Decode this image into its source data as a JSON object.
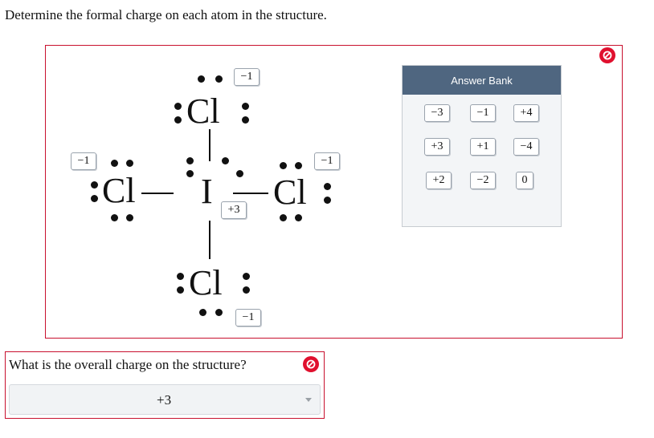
{
  "question": "Determine the formal charge on each atom in the structure.",
  "structure": {
    "atoms": {
      "top": "Cl",
      "left": "Cl",
      "center": "I",
      "right": "Cl",
      "bottom": "Cl"
    },
    "placed_charges": {
      "top": "−1",
      "left": "−1",
      "right": "−1",
      "center": "+3",
      "bottom": "−1"
    }
  },
  "answer_bank": {
    "title": "Answer Bank",
    "chips": [
      "−3",
      "−1",
      "+4",
      "+3",
      "+1",
      "−4",
      "+2",
      "−2",
      "0"
    ]
  },
  "overall": {
    "question": "What is the overall charge on the structure?",
    "selected": "+3"
  },
  "colors": {
    "incorrect": "#e0102e",
    "panel_border": "#c8102e",
    "bank_header": "#4f6680"
  },
  "icons": {
    "feedback": "incorrect-icon",
    "dropdown": "caret-down-icon"
  }
}
